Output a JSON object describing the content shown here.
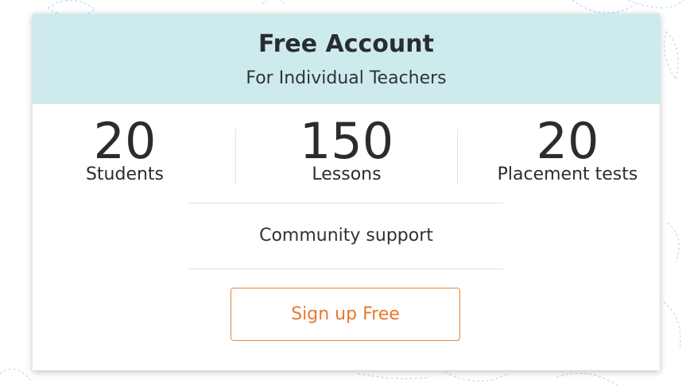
{
  "plan": {
    "title": "Free Account",
    "subtitle": "For Individual Teachers"
  },
  "stats": [
    {
      "value": "20",
      "label": "Students"
    },
    {
      "value": "150",
      "label": "Lessons"
    },
    {
      "value": "20",
      "label": "Placement tests"
    }
  ],
  "features": [
    "Community support"
  ],
  "cta": {
    "label": "Sign up Free"
  },
  "colors": {
    "header_bg": "#cdebed",
    "accent": "#e8772c",
    "text": "#2a2d30",
    "decoration": "#a8d8dc"
  },
  "decoration": {
    "icon": "leaf-pattern-icon"
  }
}
